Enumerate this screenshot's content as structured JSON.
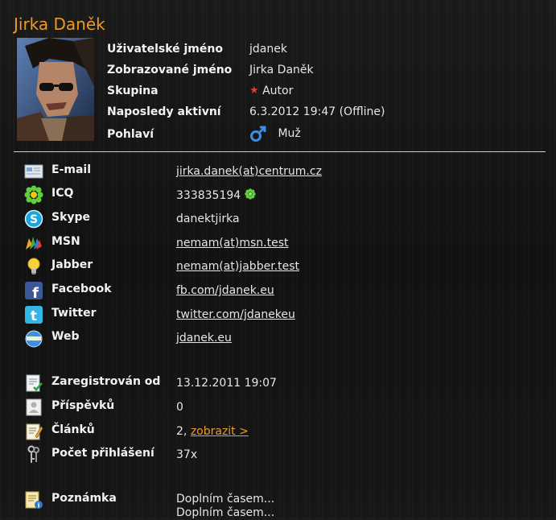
{
  "profile_name": "Jirka Daněk",
  "info": [
    {
      "label": "Uživatelské jméno",
      "value": "jdanek"
    },
    {
      "label": "Zobrazované jméno",
      "value": "Jirka Daněk"
    },
    {
      "label": "Skupina",
      "value": "Autor",
      "icon": "star-icon"
    },
    {
      "label": "Naposledy aktivní",
      "value": "6.3.2012 19:47 (Offline)"
    },
    {
      "label": "Pohlaví",
      "value": "Muž",
      "icon": "male-icon"
    }
  ],
  "contacts": [
    {
      "label": "E-mail",
      "value": "jirka.danek(at)centrum.cz",
      "link": true,
      "icon": "email-icon"
    },
    {
      "label": "ICQ",
      "value": "333835194",
      "link": false,
      "icon": "icq-icon"
    },
    {
      "label": "Skype",
      "value": "danektjirka",
      "link": false,
      "icon": "skype-icon"
    },
    {
      "label": "MSN",
      "value": "nemam(at)msn.test",
      "link": true,
      "icon": "msn-icon"
    },
    {
      "label": "Jabber",
      "value": "nemam(at)jabber.test",
      "link": true,
      "icon": "jabber-icon"
    },
    {
      "label": "Facebook",
      "value": "fb.com/jdanek.eu",
      "link": true,
      "icon": "facebook-icon"
    },
    {
      "label": "Twitter",
      "value": "twitter.com/jdanekeu",
      "link": true,
      "icon": "twitter-icon"
    },
    {
      "label": "Web",
      "value": "jdanek.eu",
      "link": true,
      "icon": "web-icon"
    }
  ],
  "stats": [
    {
      "label": "Zaregistrován od",
      "value": "13.12.2011 19:07",
      "icon": "registration-icon"
    },
    {
      "label": "Příspěvků",
      "value": "0",
      "icon": "posts-icon"
    },
    {
      "label": "Článků",
      "value": "2,",
      "link_text": "zobrazit >",
      "icon": "articles-icon"
    },
    {
      "label": "Počet přihlášení",
      "value": "37x",
      "icon": "keys-icon"
    }
  ],
  "note": {
    "label": "Poznámka",
    "lines": [
      "Doplním časem...",
      "Doplním časem..."
    ],
    "icon": "note-icon"
  },
  "colors": {
    "accent": "#f09a23",
    "background": "#151515",
    "text": "#e6e6e6"
  }
}
